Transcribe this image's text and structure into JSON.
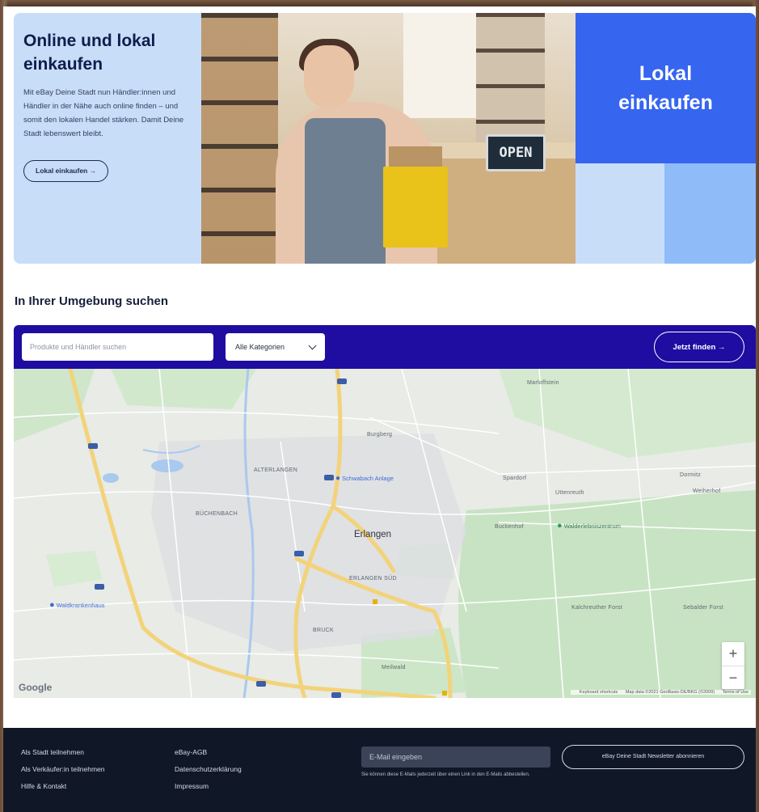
{
  "hero": {
    "title": "Online und lokal einkaufen",
    "text": "Mit eBay Deine Stadt nun Händler:innen und Händler in der Nähe auch online finden – und somit den lokalen Handel stärken. Damit Deine Stadt lebenswert bleibt.",
    "button_label": "Lokal einkaufen →",
    "open_sign": "OPEN",
    "right_title": "Lokal einkaufen"
  },
  "section": {
    "title": "In Ihrer Umgebung suchen"
  },
  "search": {
    "placeholder": "Produkte und Händler suchen",
    "category_value": "Alle Kategorien",
    "find_label": "Jetzt finden →"
  },
  "map": {
    "city": "Erlangen",
    "labels": [
      {
        "text": "Marloffstein"
      },
      {
        "text": "ALTERLANGEN"
      },
      {
        "text": "BÜCHENBACH"
      },
      {
        "text": "ERLANGEN SÜD"
      },
      {
        "text": "BRUCK"
      },
      {
        "text": "Spardorf"
      },
      {
        "text": "Uttenreuth"
      },
      {
        "text": "Buckenhof"
      },
      {
        "text": "Burgberg"
      },
      {
        "text": "Kalchreuther Forst"
      },
      {
        "text": "Sebalder Forst"
      },
      {
        "text": "Weiherhof"
      },
      {
        "text": "Dormitz"
      },
      {
        "text": "Meilwald"
      }
    ],
    "poi_green": "Walderlebniszentrum",
    "poi_blue_1": "Schwabach Anlage",
    "poi_blue_2": "Waldkrankenhaus",
    "google": "Google",
    "credits": [
      "Keyboard shortcuts",
      "Map data ©2021 GeoBasis-DE/BKG (©2009)",
      "Terms of Use"
    ],
    "zoom_in": "+",
    "zoom_out": "−"
  },
  "footer": {
    "col1": [
      "Als Stadt teilnehmen",
      "Als Verkäufer:in teilnehmen",
      "Hilfe & Kontakt"
    ],
    "col2": [
      "eBay-AGB",
      "Datenschutzerklärung",
      "Impressum"
    ],
    "newsletter_placeholder": "E-Mail eingeben",
    "newsletter_note": "Sie können diese E-Mails jederzeit über einen Link in den E-Mails abbestellen.",
    "newsletter_button": "eBay Deine Stadt Newsletter abonnieren"
  },
  "colors": {
    "hero_blue": "#3665f0",
    "hero_light": "#c8ddf8",
    "search_bar": "#1e0da0",
    "footer_bg": "#101727"
  }
}
